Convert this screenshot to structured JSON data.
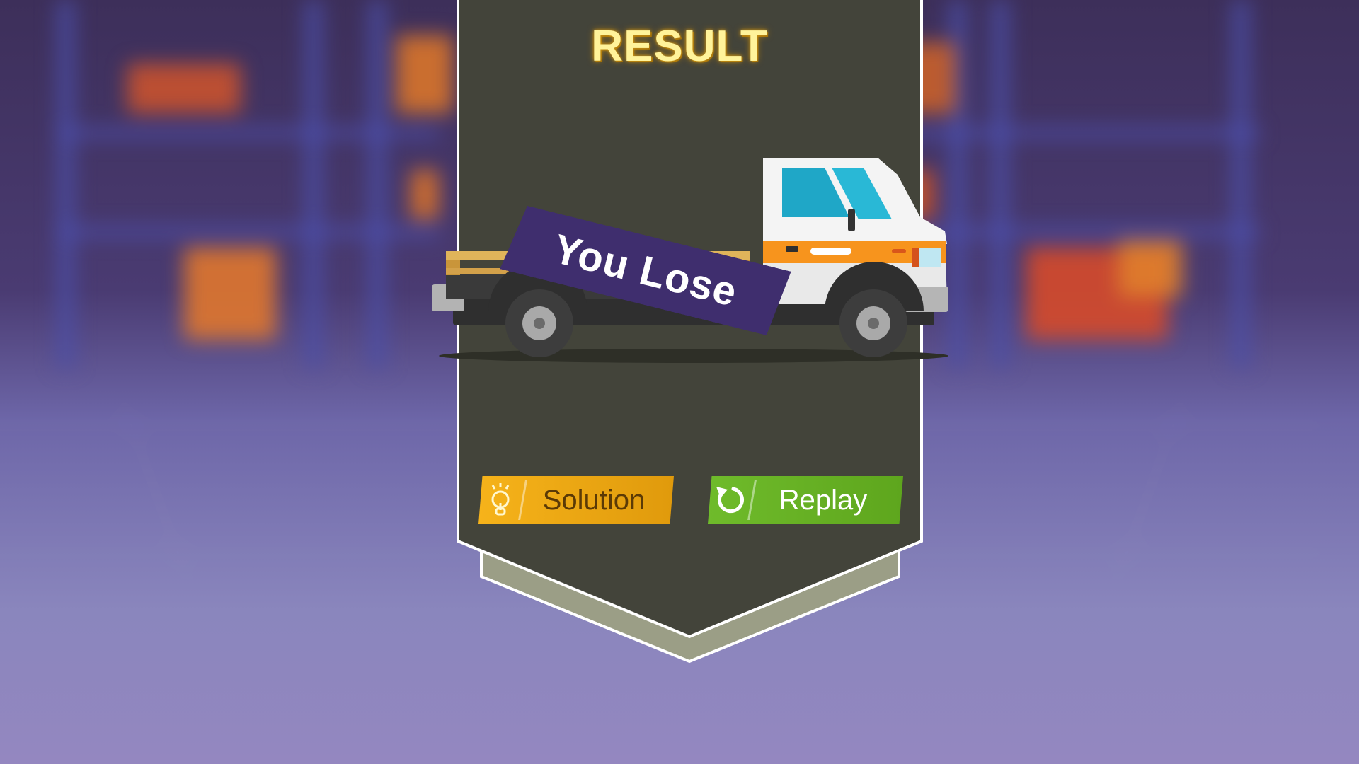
{
  "result_panel": {
    "title": "RESULT",
    "status_banner": "You Lose",
    "buttons": {
      "solution_label": "Solution",
      "replay_label": "Replay"
    }
  },
  "icons": {
    "solution": "lightbulb-icon",
    "replay": "replay-arrow-icon"
  },
  "colors": {
    "title": "#fff39a",
    "panel": "#43443a",
    "banner": "#3f2e6e",
    "solution_button": "#f6b31a",
    "replay_button": "#6fbb2b"
  }
}
